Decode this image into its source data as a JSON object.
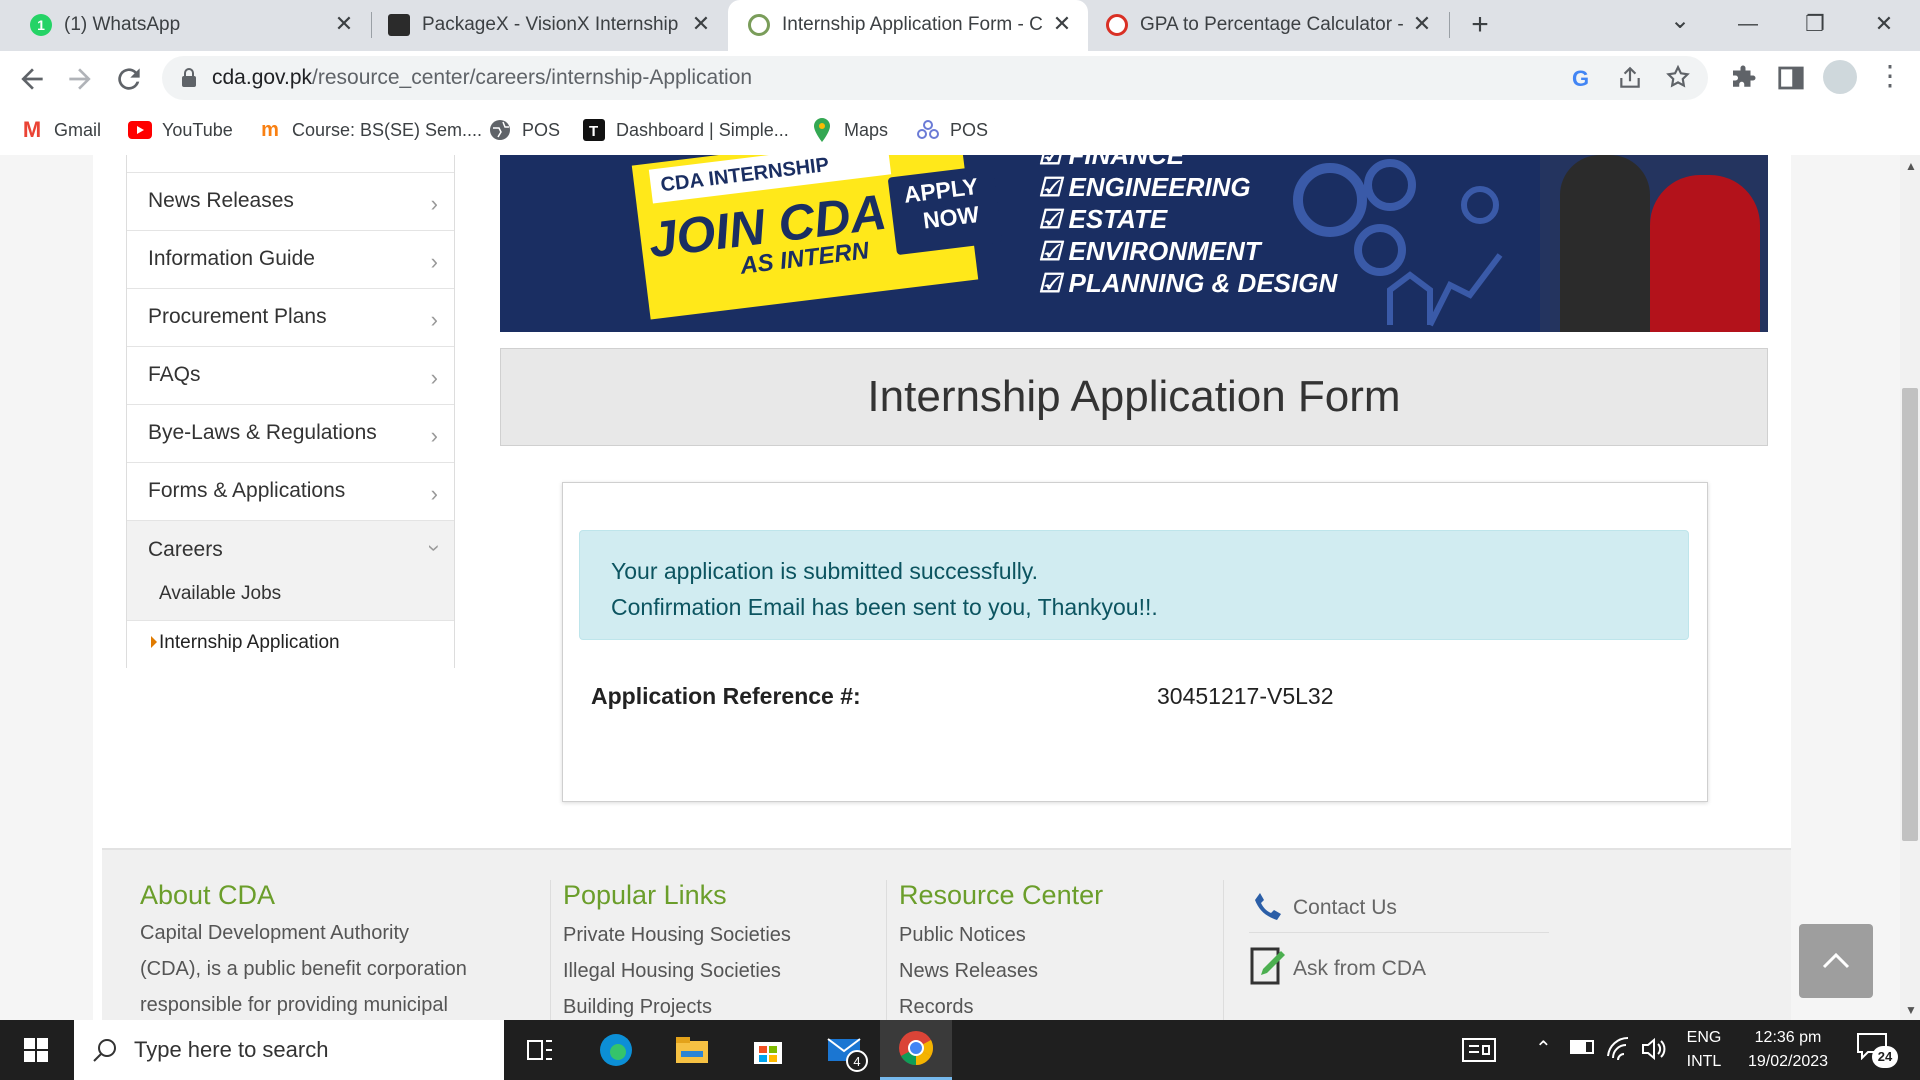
{
  "tabs": [
    {
      "title": "(1) WhatsApp",
      "favicon": "whatsapp-icon",
      "close": "✕"
    },
    {
      "title": "PackageX - VisionX Internship Pr",
      "favicon": "packagex-icon",
      "close": "✕"
    },
    {
      "title": "Internship Application Form - CD",
      "favicon": "cda-icon",
      "close": "✕"
    },
    {
      "title": "GPA to Percentage Calculator - G",
      "favicon": "calculator-icon",
      "close": "✕"
    }
  ],
  "new_tab": "+",
  "window_controls": {
    "tab_search": "⌄",
    "minimize": "—",
    "restore": "❐",
    "close": "✕"
  },
  "address": {
    "domain": "cda.gov.pk",
    "path": "/resource_center/careers/internship-Application"
  },
  "bookmarks": [
    {
      "label": "Gmail",
      "icon": "gmail-icon"
    },
    {
      "label": "YouTube",
      "icon": "youtube-icon"
    },
    {
      "label": "Course: BS(SE) Sem....",
      "icon": "moodle-icon"
    },
    {
      "label": "POS",
      "icon": "globe-icon"
    },
    {
      "label": "Dashboard | Simple...",
      "icon": "dashboard-icon"
    },
    {
      "label": "Maps",
      "icon": "maps-icon"
    },
    {
      "label": "POS",
      "icon": "pos-icon"
    }
  ],
  "sidebar": {
    "items": [
      {
        "label": "News Releases"
      },
      {
        "label": "Information Guide"
      },
      {
        "label": "Procurement Plans"
      },
      {
        "label": "FAQs"
      },
      {
        "label": "Bye-Laws & Regulations"
      },
      {
        "label": "Forms & Applications"
      },
      {
        "label": "Careers"
      }
    ],
    "sub_items": [
      {
        "label": "Available Jobs"
      },
      {
        "label": "Internship Application"
      }
    ]
  },
  "banner": {
    "top_label": "CDA INTERNSHIP",
    "join": "JOIN CDA",
    "as_intern": "AS INTERN",
    "apply": "APPLY",
    "now": "NOW",
    "fields": [
      "FINANCE",
      "ENGINEERING",
      "ESTATE",
      "ENVIRONMENT",
      "PLANNING & DESIGN"
    ]
  },
  "form": {
    "title": "Internship Application Form",
    "success_line1": "Your application is submitted successfully.",
    "success_line2": "Confirmation Email has been sent to you, Thankyou!!.",
    "ref_label": "Application Reference #:",
    "ref_value": "30451217-V5L32"
  },
  "footer": {
    "about": {
      "title": "About CDA",
      "text": [
        "Capital Development Authority",
        "(CDA), is a public benefit corporation",
        "responsible for providing municipal"
      ]
    },
    "popular": {
      "title": "Popular Links",
      "links": [
        "Private Housing Societies",
        "Illegal Housing Societies",
        "Building Projects"
      ]
    },
    "resource": {
      "title": "Resource Center",
      "links": [
        "Public Notices",
        "News Releases",
        "Records"
      ]
    },
    "contact": {
      "label": "Contact Us"
    },
    "ask": {
      "label": "Ask from CDA"
    }
  },
  "scroll_to_top": "^",
  "taskbar": {
    "search_placeholder": "Type here to search",
    "mail_badge": "4",
    "lang_top": "ENG",
    "lang_bottom": "INTL",
    "time": "12:36 pm",
    "date": "19/02/2023",
    "notification_count": "24"
  }
}
